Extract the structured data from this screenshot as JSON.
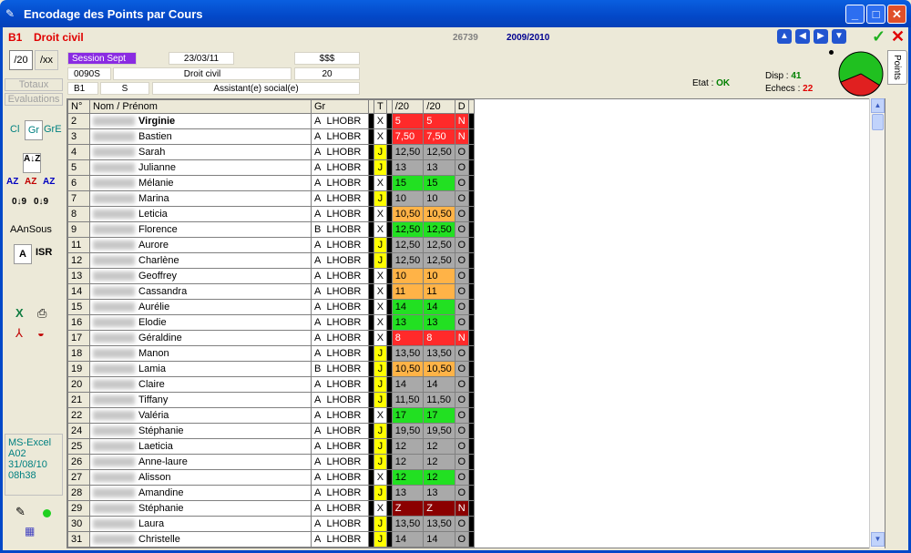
{
  "window": {
    "title": "Encodage des Points par Cours",
    "title_icon": "app-icon"
  },
  "header": {
    "class_code": "B1",
    "course": "Droit civil",
    "id": "26739",
    "year": "2009/2010"
  },
  "info": {
    "session": "Session Sept",
    "date": "23/03/11",
    "dollars": "$$$",
    "code": "0090S",
    "course_name": "Droit civil",
    "max": "20",
    "class": "B1",
    "s": "S",
    "program": "Assistant(e) social(e)"
  },
  "scale_buttons": [
    "/20",
    "/xx"
  ],
  "left_buttons": {
    "totaux": "Totaux",
    "evaluations": "Evaluations",
    "cl": "Cl",
    "gr": "Gr",
    "gre": "GrE",
    "aansous": "AAnSous",
    "a": "A",
    "isr": "ISR"
  },
  "left_info": {
    "app": "MS-Excel",
    "room": "A02",
    "date": "31/08/10",
    "time": "08h38"
  },
  "stats": {
    "etat_label": "Etat :",
    "etat_value": "OK",
    "disp_label": "Disp :",
    "disp_value": "41",
    "echecs_label": "Echecs :",
    "echecs_value": "22"
  },
  "pie": {
    "ok_fraction": 0.65,
    "ok_color": "#20c020",
    "fail_color": "#e02020"
  },
  "tab_label": "Points",
  "columns": [
    "N°",
    "Nom / Prénom",
    "Gr",
    "T",
    "/20",
    "/20",
    "D"
  ],
  "colors": {
    "red": "#ff2a2a",
    "orange": "#ffb347",
    "green": "#22e022",
    "gray": "#a9a9a9",
    "darkred": "#8b0000",
    "yellow": "#ffff00"
  },
  "rows": [
    {
      "n": "2",
      "name": "Virginie",
      "bold": true,
      "g": "A",
      "grp": "LHOBR",
      "t": "X",
      "v1": "5",
      "v2": "5",
      "d": "N",
      "c": "red"
    },
    {
      "n": "3",
      "name": "Bastien",
      "g": "A",
      "grp": "LHOBR",
      "t": "X",
      "v1": "7,50",
      "v2": "7,50",
      "d": "N",
      "c": "red"
    },
    {
      "n": "4",
      "name": "Sarah",
      "g": "A",
      "grp": "LHOBR",
      "t": "J",
      "v1": "12,50",
      "v2": "12,50",
      "d": "O",
      "c": "gray"
    },
    {
      "n": "5",
      "name": "Julianne",
      "g": "A",
      "grp": "LHOBR",
      "t": "J",
      "v1": "13",
      "v2": "13",
      "d": "O",
      "c": "gray"
    },
    {
      "n": "6",
      "name": "Mélanie",
      "g": "A",
      "grp": "LHOBR",
      "t": "X",
      "v1": "15",
      "v2": "15",
      "d": "O",
      "c": "green"
    },
    {
      "n": "7",
      "name": "Marina",
      "g": "A",
      "grp": "LHOBR",
      "t": "J",
      "v1": "10",
      "v2": "10",
      "d": "O",
      "c": "gray"
    },
    {
      "n": "8",
      "name": "Leticia",
      "g": "A",
      "grp": "LHOBR",
      "t": "X",
      "v1": "10,50",
      "v2": "10,50",
      "d": "O",
      "c": "orange"
    },
    {
      "n": "9",
      "name": "Florence",
      "g": "B",
      "grp": "LHOBR",
      "t": "X",
      "v1": "12,50",
      "v2": "12,50",
      "d": "O",
      "c": "green"
    },
    {
      "n": "11",
      "name": "Aurore",
      "g": "A",
      "grp": "LHOBR",
      "t": "J",
      "v1": "12,50",
      "v2": "12,50",
      "d": "O",
      "c": "gray"
    },
    {
      "n": "12",
      "name": "Charlène",
      "g": "A",
      "grp": "LHOBR",
      "t": "J",
      "v1": "12,50",
      "v2": "12,50",
      "d": "O",
      "c": "gray"
    },
    {
      "n": "13",
      "name": "Geoffrey",
      "g": "A",
      "grp": "LHOBR",
      "t": "X",
      "v1": "10",
      "v2": "10",
      "d": "O",
      "c": "orange"
    },
    {
      "n": "14",
      "name": "Cassandra",
      "g": "A",
      "grp": "LHOBR",
      "t": "X",
      "v1": "11",
      "v2": "11",
      "d": "O",
      "c": "orange"
    },
    {
      "n": "15",
      "name": "Aurélie",
      "g": "A",
      "grp": "LHOBR",
      "t": "X",
      "v1": "14",
      "v2": "14",
      "d": "O",
      "c": "green"
    },
    {
      "n": "16",
      "name": "Elodie",
      "g": "A",
      "grp": "LHOBR",
      "t": "X",
      "v1": "13",
      "v2": "13",
      "d": "O",
      "c": "green"
    },
    {
      "n": "17",
      "name": "Géraldine",
      "g": "A",
      "grp": "LHOBR",
      "t": "X",
      "v1": "8",
      "v2": "8",
      "d": "N",
      "c": "red"
    },
    {
      "n": "18",
      "name": "Manon",
      "g": "A",
      "grp": "LHOBR",
      "t": "J",
      "v1": "13,50",
      "v2": "13,50",
      "d": "O",
      "c": "gray"
    },
    {
      "n": "19",
      "name": "Lamia",
      "g": "B",
      "grp": "LHOBR",
      "t": "J",
      "v1": "10,50",
      "v2": "10,50",
      "d": "O",
      "c": "orange"
    },
    {
      "n": "20",
      "name": "Claire",
      "g": "A",
      "grp": "LHOBR",
      "t": "J",
      "v1": "14",
      "v2": "14",
      "d": "O",
      "c": "gray"
    },
    {
      "n": "21",
      "name": "Tiffany",
      "g": "A",
      "grp": "LHOBR",
      "t": "J",
      "v1": "11,50",
      "v2": "11,50",
      "d": "O",
      "c": "gray"
    },
    {
      "n": "22",
      "name": "Valéria",
      "g": "A",
      "grp": "LHOBR",
      "t": "X",
      "v1": "17",
      "v2": "17",
      "d": "O",
      "c": "green"
    },
    {
      "n": "24",
      "name": "Stéphanie",
      "g": "A",
      "grp": "LHOBR",
      "t": "J",
      "v1": "19,50",
      "v2": "19,50",
      "d": "O",
      "c": "gray"
    },
    {
      "n": "25",
      "name": "Laeticia",
      "g": "A",
      "grp": "LHOBR",
      "t": "J",
      "v1": "12",
      "v2": "12",
      "d": "O",
      "c": "gray"
    },
    {
      "n": "26",
      "name": "Anne-laure",
      "g": "A",
      "grp": "LHOBR",
      "t": "J",
      "v1": "12",
      "v2": "12",
      "d": "O",
      "c": "gray"
    },
    {
      "n": "27",
      "name": "Alisson",
      "g": "A",
      "grp": "LHOBR",
      "t": "X",
      "v1": "12",
      "v2": "12",
      "d": "O",
      "c": "green"
    },
    {
      "n": "28",
      "name": "Amandine",
      "g": "A",
      "grp": "LHOBR",
      "t": "J",
      "v1": "13",
      "v2": "13",
      "d": "O",
      "c": "gray"
    },
    {
      "n": "29",
      "name": "Stéphanie",
      "g": "A",
      "grp": "LHOBR",
      "t": "X",
      "v1": "Z",
      "v2": "Z",
      "d": "N",
      "c": "darkred"
    },
    {
      "n": "30",
      "name": "Laura",
      "g": "A",
      "grp": "LHOBR",
      "t": "J",
      "v1": "13,50",
      "v2": "13,50",
      "d": "O",
      "c": "gray"
    },
    {
      "n": "31",
      "name": "Christelle",
      "g": "A",
      "grp": "LHOBR",
      "t": "J",
      "v1": "14",
      "v2": "14",
      "d": "O",
      "c": "gray"
    }
  ]
}
